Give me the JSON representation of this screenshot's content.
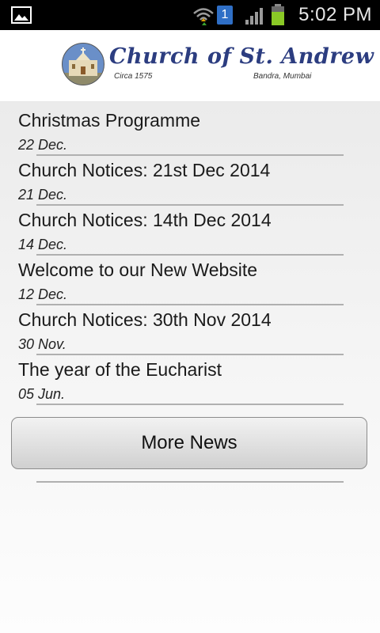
{
  "status_bar": {
    "notification_count": "1",
    "time": "5:02 PM",
    "icons": [
      "image-notification-icon",
      "wifi-icon",
      "signal-icon",
      "battery-icon"
    ],
    "battery_color": "#8ac926"
  },
  "header": {
    "logo_title": "Church of St. Andrew",
    "circa": "Circa 1575",
    "place": "Bandra, Mumbai",
    "title_color": "#2c3d80"
  },
  "news": {
    "items": [
      {
        "title": "Christmas Programme",
        "date": "22 Dec."
      },
      {
        "title": "Church Notices: 21st Dec 2014",
        "date": "21 Dec."
      },
      {
        "title": "Church Notices: 14th Dec 2014",
        "date": "14 Dec."
      },
      {
        "title": "Welcome to our New Website",
        "date": "12 Dec."
      },
      {
        "title": "Church Notices: 30th Nov 2014",
        "date": "30 Nov."
      },
      {
        "title": "The year of the Eucharist",
        "date": "05 Jun."
      }
    ],
    "more_label": "More News"
  }
}
